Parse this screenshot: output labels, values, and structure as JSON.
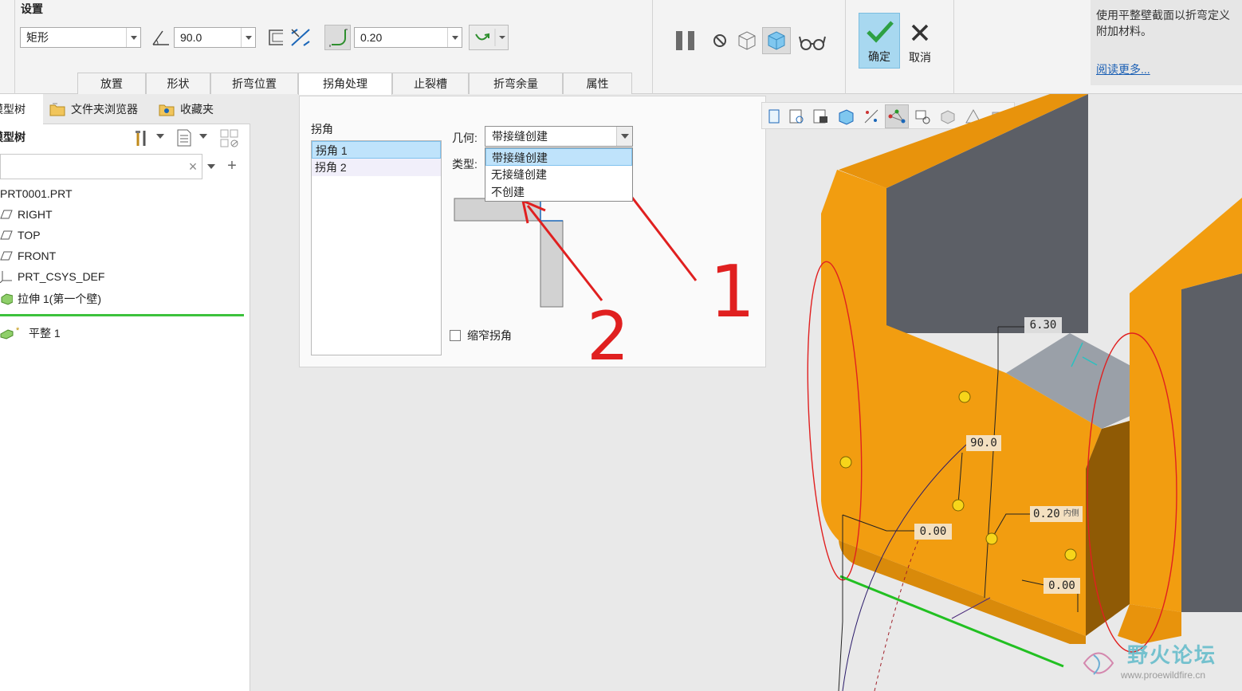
{
  "ribbon": {
    "group_title": "设置",
    "shape_value": "矩形",
    "angle_value": "90.0",
    "radius_value": "0.20",
    "tabs": [
      {
        "label": "放置"
      },
      {
        "label": "形状"
      },
      {
        "label": "折弯位置"
      },
      {
        "label": "拐角处理"
      },
      {
        "label": "止裂槽"
      },
      {
        "label": "折弯余量"
      },
      {
        "label": "属性"
      }
    ],
    "active_tab": "拐角处理",
    "ok_label": "确定",
    "cancel_label": "取消",
    "help_text": "使用平整壁截面以折弯定义附加材料。",
    "help_link": "阅读更多..."
  },
  "left_panel": {
    "tabs": [
      {
        "label": "模型树"
      },
      {
        "label": "文件夹浏览器"
      },
      {
        "label": "收藏夹"
      }
    ],
    "tree_header": "模型树",
    "items": [
      {
        "label": "PRT0001.PRT"
      },
      {
        "label": "RIGHT"
      },
      {
        "label": "TOP"
      },
      {
        "label": "FRONT"
      },
      {
        "label": "PRT_CSYS_DEF"
      },
      {
        "label": "拉伸 1(第一个壁)"
      },
      {
        "label": "平整 1"
      }
    ]
  },
  "corner_panel": {
    "list_title": "拐角",
    "corners": [
      {
        "label": "拐角 1"
      },
      {
        "label": "拐角 2"
      }
    ],
    "geometry_label": "几何:",
    "geometry_value": "带接缝创建",
    "type_label": "类型:",
    "geometry_options": [
      {
        "label": "带接缝创建"
      },
      {
        "label": "无接缝创建"
      },
      {
        "label": "不创建"
      }
    ],
    "narrow_label": "缩窄拐角"
  },
  "viewport": {
    "dims": [
      "6.30",
      "90.0",
      "0.20",
      "0.00",
      "0.00"
    ],
    "dim_suffix": "内侧",
    "annotation_1": "1",
    "annotation_2": "2",
    "watermark_title": "野火论坛",
    "watermark_url": "www.proewildfire.cn"
  },
  "colors": {
    "part_orange": "#f29d10",
    "part_dark": "#5c5f66",
    "accent_blue": "#a8d8f0",
    "annotation_red": "#e02020"
  }
}
